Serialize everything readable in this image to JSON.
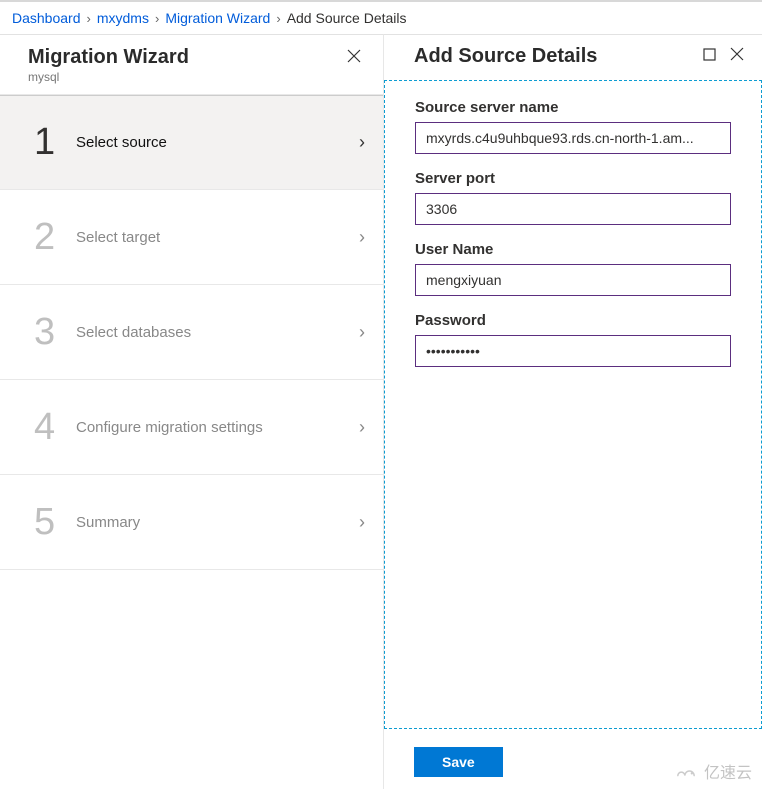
{
  "breadcrumb": {
    "items": [
      {
        "label": "Dashboard",
        "link": true
      },
      {
        "label": "mxydms",
        "link": true
      },
      {
        "label": "Migration Wizard",
        "link": true
      },
      {
        "label": "Add Source Details",
        "link": false
      }
    ]
  },
  "wizard": {
    "title": "Migration Wizard",
    "subtitle": "mysql",
    "steps": [
      {
        "num": "1",
        "label": "Select source",
        "active": true
      },
      {
        "num": "2",
        "label": "Select target",
        "active": false
      },
      {
        "num": "3",
        "label": "Select databases",
        "active": false
      },
      {
        "num": "4",
        "label": "Configure migration settings",
        "active": false
      },
      {
        "num": "5",
        "label": "Summary",
        "active": false
      }
    ]
  },
  "panel": {
    "title": "Add Source Details",
    "fields": {
      "server_name_label": "Source server name",
      "server_name_value": "mxyrds.c4u9uhbque93.rds.cn-north-1.am...",
      "server_port_label": "Server port",
      "server_port_value": "3306",
      "user_name_label": "User Name",
      "user_name_value": "mengxiyuan",
      "password_label": "Password",
      "password_value": "•••••••••••"
    },
    "save_label": "Save"
  },
  "watermark_text": "亿速云"
}
